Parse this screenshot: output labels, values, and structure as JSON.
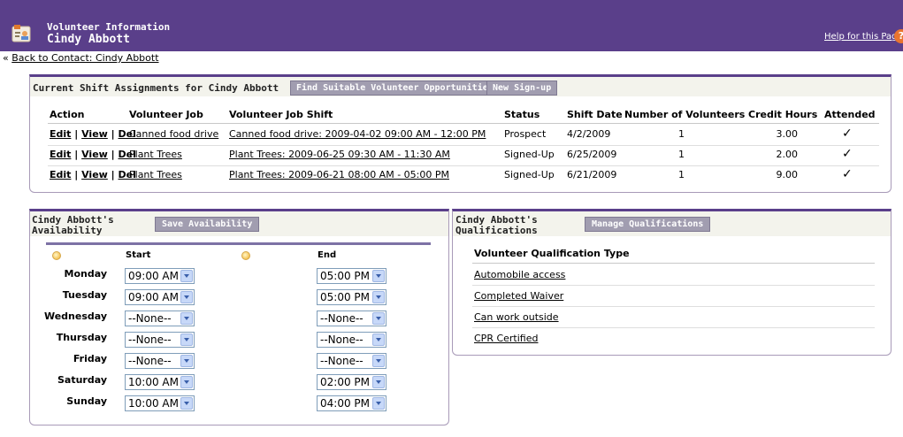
{
  "header": {
    "kicker": "Volunteer Information",
    "title": "Cindy Abbott",
    "help_link": "Help for this Page",
    "help_icon": "help-icon"
  },
  "back_link": {
    "prefix": "«",
    "label": "Back to Contact: Cindy Abbott"
  },
  "shifts": {
    "title": "Current Shift Assignments for Cindy Abbott",
    "buttons": [
      "Find Suitable Volunteer Opportunities",
      "New Sign-up"
    ],
    "columns": [
      "Action",
      "Volunteer Job",
      "Volunteer Job Shift",
      "Status",
      "Shift Date",
      "Number of Volunteers",
      "Credit Hours",
      "Attended"
    ],
    "action_links": [
      "Edit",
      "View",
      "Del"
    ],
    "rows": [
      {
        "job": "Canned food drive",
        "shift": "Canned food drive: 2009-04-02 09:00 AM - 12:00 PM",
        "status": "Prospect",
        "date": "4/2/2009",
        "volunteers": "1",
        "hours": "3.00",
        "attended": "✓"
      },
      {
        "job": "Plant Trees",
        "shift": "Plant Trees: 2009-06-25 09:30 AM - 11:30 AM",
        "status": "Signed-Up",
        "date": "6/25/2009",
        "volunteers": "1",
        "hours": "2.00",
        "attended": "✓"
      },
      {
        "job": "Plant Trees",
        "shift": "Plant Trees: 2009-06-21 08:00 AM - 05:00 PM",
        "status": "Signed-Up",
        "date": "6/21/2009",
        "volunteers": "1",
        "hours": "9.00",
        "attended": "✓"
      }
    ]
  },
  "availability": {
    "title_line1": "Cindy Abbott's",
    "title_line2": "Availability",
    "save_button": "Save Availability",
    "start_header": "Start",
    "end_header": "End",
    "days": [
      {
        "day": "Monday",
        "start": "09:00 AM",
        "end": "05:00 PM"
      },
      {
        "day": "Tuesday",
        "start": "09:00 AM",
        "end": "05:00 PM"
      },
      {
        "day": "Wednesday",
        "start": "--None--",
        "end": "--None--"
      },
      {
        "day": "Thursday",
        "start": "--None--",
        "end": "--None--"
      },
      {
        "day": "Friday",
        "start": "--None--",
        "end": "--None--"
      },
      {
        "day": "Saturday",
        "start": "10:00 AM",
        "end": "02:00 PM"
      },
      {
        "day": "Sunday",
        "start": "10:00 AM",
        "end": "04:00 PM"
      }
    ]
  },
  "qualifications": {
    "title_line1": "Cindy Abbott's",
    "title_line2": "Qualifications",
    "manage_button": "Manage Qualifications",
    "column": "Volunteer Qualification Type",
    "items": [
      "Automobile access",
      "Completed Waiver",
      "Can work outside",
      "CPR Certified"
    ]
  },
  "colors": {
    "header_bg": "#5a3f8a",
    "button_bg": "#a19db0",
    "panel_head_bg": "#f3f3ec"
  }
}
